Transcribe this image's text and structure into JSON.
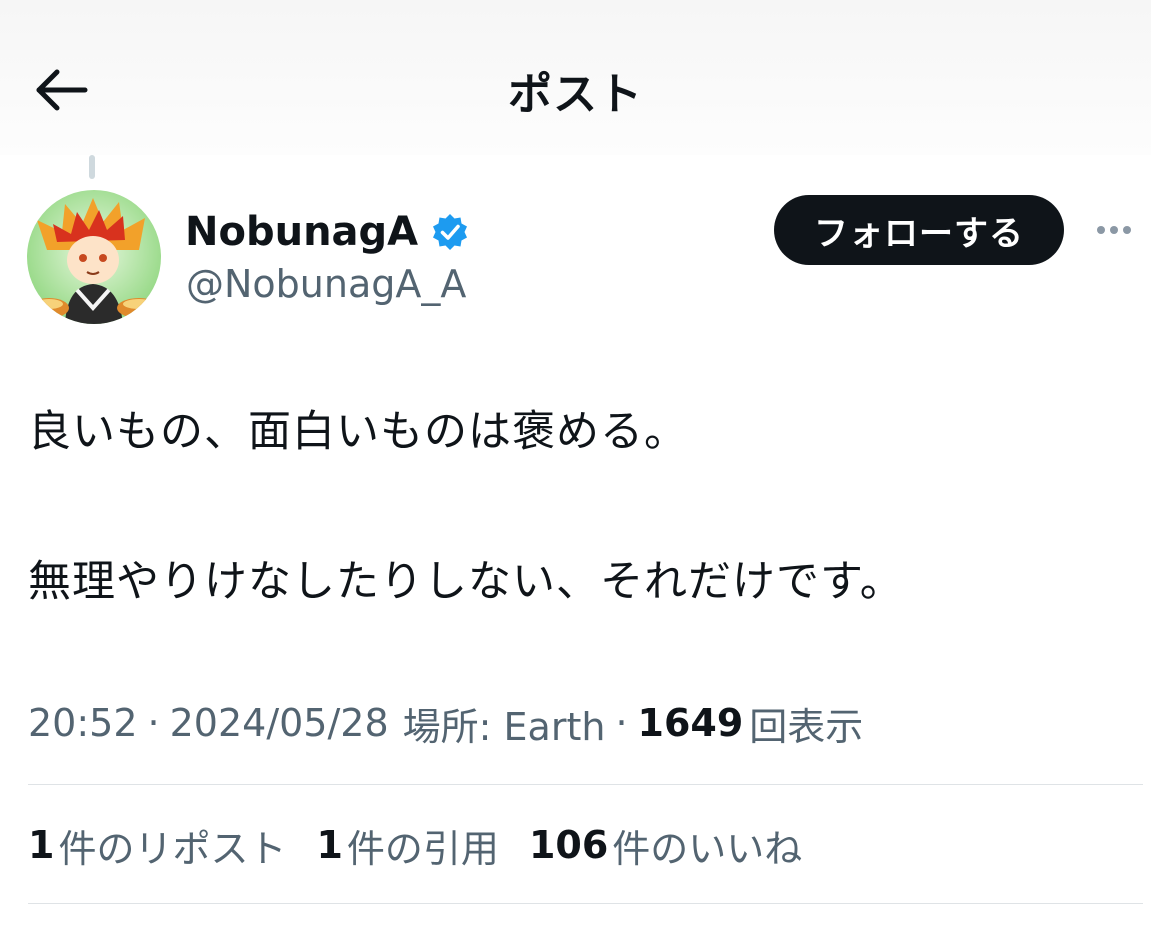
{
  "header": {
    "title": "ポスト",
    "back_icon": "arrow-left-icon"
  },
  "author": {
    "display_name": "NobunagA",
    "handle": "@NobunagA_A",
    "verified_icon": "verified-badge-icon",
    "verified_color": "#1d9bf0",
    "avatar": "avatar-illustration"
  },
  "actions": {
    "follow_label": "フォローする",
    "more_icon": "more-horizontal-icon"
  },
  "tweet": {
    "line1": "良いもの、面白いものは褒める。",
    "line2": "無理やりけなしたりしない、それだけです。"
  },
  "meta": {
    "time": "20:52",
    "separator": "·",
    "date": "2024/05/28",
    "location": "場所: Earth",
    "views_count": "1649",
    "views_label": "回表示"
  },
  "stats": {
    "reposts_count": "1",
    "reposts_label": "件のリポスト",
    "quotes_count": "1",
    "quotes_label": "件の引用",
    "likes_count": "106",
    "likes_label": "件のいいね"
  },
  "colors": {
    "text_primary": "#0f1419",
    "text_secondary": "#536471",
    "follow_bg": "#0f1419",
    "divider": "#dfe3e6"
  }
}
